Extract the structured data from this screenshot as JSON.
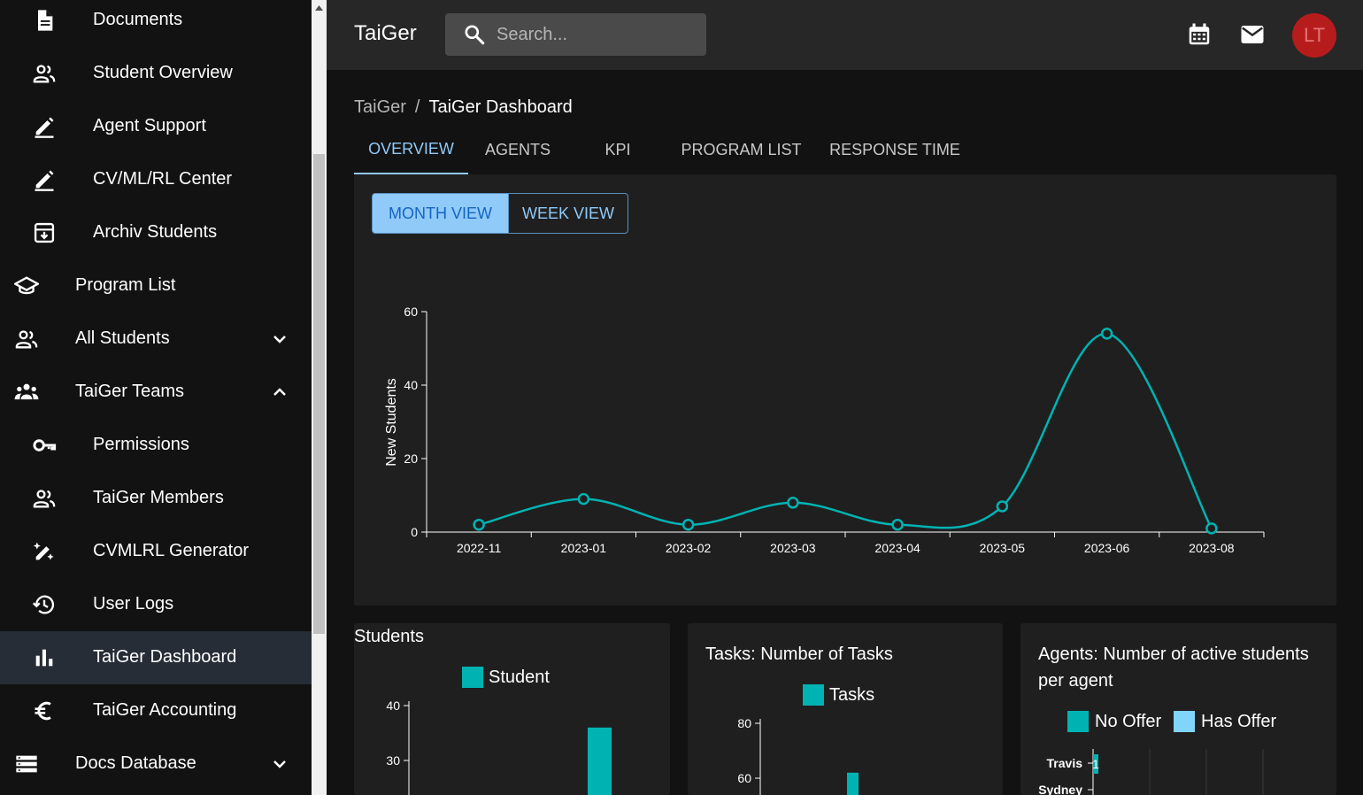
{
  "sidebar": {
    "items": [
      {
        "label": "Documents",
        "icon": "document-icon"
      },
      {
        "label": "Student Overview",
        "icon": "people-icon"
      },
      {
        "label": "Agent Support",
        "icon": "edit-icon"
      },
      {
        "label": "CV/ML/RL Center",
        "icon": "edit-icon"
      },
      {
        "label": "Archiv Students",
        "icon": "archive-icon"
      },
      {
        "label": "Program List",
        "icon": "school-icon"
      },
      {
        "label": "All Students",
        "icon": "people-icon",
        "chevron": "down"
      },
      {
        "label": "TaiGer Teams",
        "icon": "groups-icon",
        "chevron": "up"
      },
      {
        "label": "Permissions",
        "icon": "key-icon"
      },
      {
        "label": "TaiGer Members",
        "icon": "people-icon"
      },
      {
        "label": "CVMLRL Generator",
        "icon": "magic-edit-icon"
      },
      {
        "label": "User Logs",
        "icon": "history-icon"
      },
      {
        "label": "TaiGer Dashboard",
        "icon": "bar-chart-icon",
        "active": true
      },
      {
        "label": "TaiGer Accounting",
        "icon": "euro-icon"
      },
      {
        "label": "Docs Database",
        "icon": "storage-icon",
        "chevron": "down"
      }
    ]
  },
  "topbar": {
    "brand": "TaiGer",
    "search_placeholder": "Search...",
    "avatar": "LT"
  },
  "breadcrumb": {
    "root": "TaiGer",
    "sep": "/",
    "current": "TaiGer Dashboard"
  },
  "tabs": [
    "OVERVIEW",
    "AGENTS",
    "KPI",
    "PROGRAM LIST",
    "RESPONSE TIME"
  ],
  "view_toggle": {
    "month": "MONTH VIEW",
    "week": "WEEK VIEW"
  },
  "colors": {
    "accent": "#90caf9",
    "series": "#00b3b3",
    "has_offer": "#81d4fa",
    "avatar": "#b71c1c"
  },
  "chart_data": [
    {
      "type": "line",
      "ylabel": "New Students",
      "x": [
        "2022-11",
        "2023-01",
        "2023-02",
        "2023-03",
        "2023-04",
        "2023-05",
        "2023-06",
        "2023-08"
      ],
      "values": [
        2,
        9,
        2,
        8,
        2,
        7,
        54,
        1
      ],
      "ylim": [
        0,
        60
      ],
      "yticks": [
        0,
        20,
        40,
        60
      ]
    },
    {
      "type": "bar",
      "title": "Students",
      "series": [
        {
          "name": "Student"
        }
      ],
      "yticks": [
        30,
        40
      ],
      "visible_bar_value": 36
    },
    {
      "type": "bar",
      "title": "Tasks: Number of Tasks",
      "series": [
        {
          "name": "Tasks"
        }
      ],
      "yticks": [
        60,
        80
      ],
      "visible_bar_value": 62
    },
    {
      "type": "bar",
      "title": "Agents: Number of active students per agent",
      "series": [
        {
          "name": "No Offer"
        },
        {
          "name": "Has Offer"
        }
      ],
      "categories": [
        "Travis",
        "Sydney"
      ],
      "data_labels": [
        "1"
      ]
    }
  ]
}
